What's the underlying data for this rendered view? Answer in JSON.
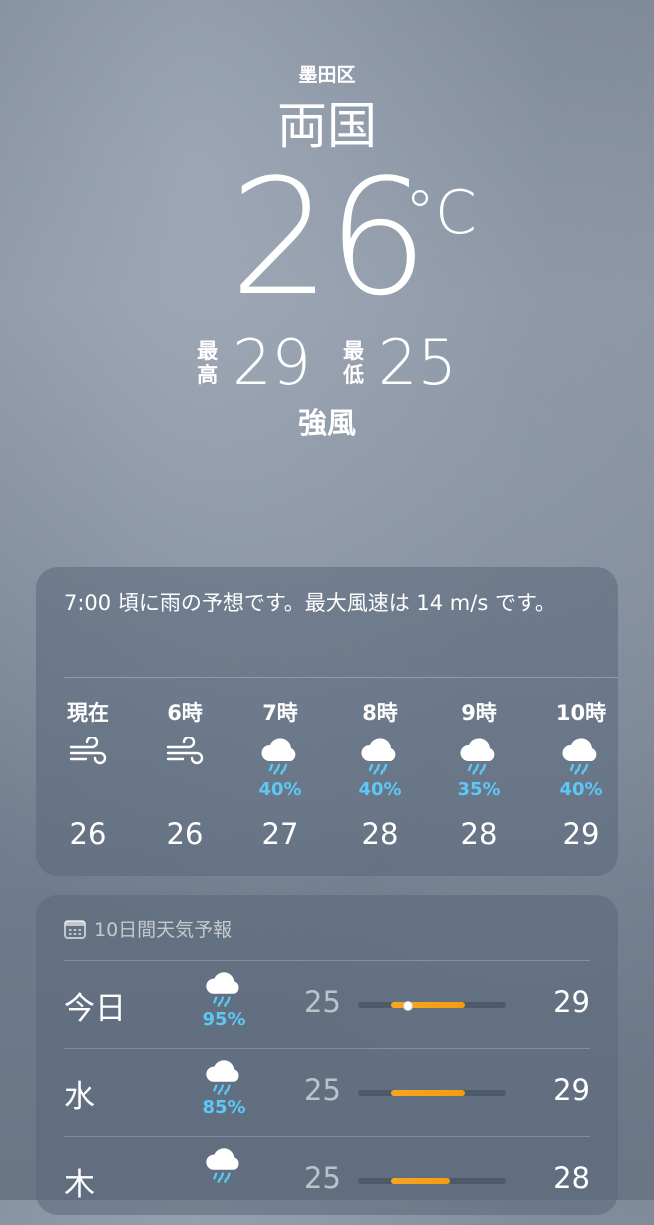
{
  "location": {
    "district": "墨田区",
    "city": "両国"
  },
  "current": {
    "temp": "26",
    "unit": "°C",
    "high_label_1": "最",
    "high_label_2": "高",
    "high": "29",
    "low_label_1": "最",
    "low_label_2": "低",
    "low": "25",
    "condition": "強風"
  },
  "hourly": {
    "summary": "7:00 頃に雨の予想です。最大風速は 14 m/s です。",
    "items": [
      {
        "label": "現在",
        "icon": "wind-icon",
        "pop": "",
        "temp": "26"
      },
      {
        "label": "6時",
        "icon": "wind-icon",
        "pop": "",
        "temp": "26"
      },
      {
        "label": "7時",
        "icon": "cloud-rain-icon",
        "pop": "40%",
        "temp": "27"
      },
      {
        "label": "8時",
        "icon": "cloud-rain-icon",
        "pop": "40%",
        "temp": "28"
      },
      {
        "label": "9時",
        "icon": "cloud-rain-icon",
        "pop": "35%",
        "temp": "28"
      },
      {
        "label": "10時",
        "icon": "cloud-rain-icon",
        "pop": "40%",
        "temp": "29"
      }
    ]
  },
  "ten_day": {
    "title": "10日間天気予報",
    "days": [
      {
        "name": "今日",
        "icon": "cloud-rain-icon",
        "pop": "95%",
        "low": "25",
        "high": "29",
        "range_start": 0.22,
        "range_end": 0.72,
        "current": 0.33
      },
      {
        "name": "水",
        "icon": "cloud-rain-icon",
        "pop": "85%",
        "low": "25",
        "high": "29",
        "range_start": 0.22,
        "range_end": 0.72
      },
      {
        "name": "木",
        "icon": "cloud-rain-icon",
        "pop": "",
        "low": "25",
        "high": "28",
        "range_start": 0.22,
        "range_end": 0.62
      }
    ]
  },
  "colors": {
    "precip": "#5cc8f5",
    "range_bar": "#f5a623"
  }
}
